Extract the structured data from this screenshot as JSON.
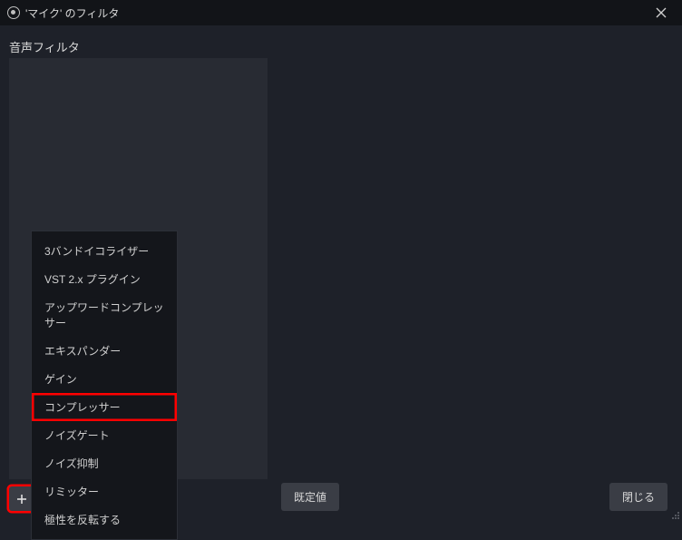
{
  "title": "'マイク' のフィルタ",
  "section": "音声フィルタ",
  "menu": {
    "items": [
      "3バンドイコライザー",
      "VST 2.x プラグイン",
      "アップワードコンプレッサー",
      "エキスパンダー",
      "ゲイン",
      "コンプレッサー",
      "ノイズゲート",
      "ノイズ抑制",
      "リミッター",
      "極性を反転する"
    ],
    "highlighted_index": 5
  },
  "buttons": {
    "defaults": "既定値",
    "close": "閉じる"
  }
}
